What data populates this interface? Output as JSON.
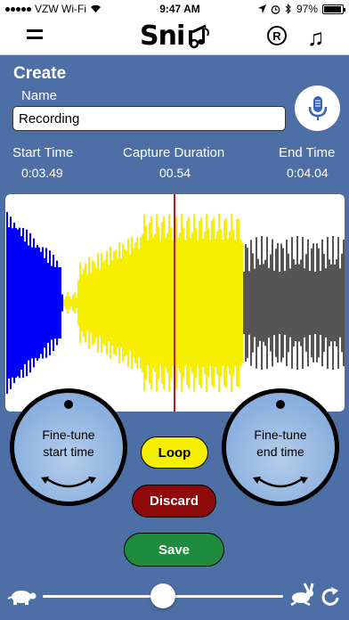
{
  "status": {
    "carrier": "VZW Wi-Fi",
    "time": "9:47 AM",
    "battery": "97%",
    "battery_level": 0.97
  },
  "nav": {
    "logo_text": "Sni",
    "reg_symbol": "R",
    "menu_icon": "menu-icon",
    "music_icon": "music-note-icon"
  },
  "create": {
    "title": "Create",
    "name_label": "Name",
    "name_value": "Recording"
  },
  "times": {
    "start_label": "Start Time",
    "start_value": "0:03.49",
    "duration_label": "Capture Duration",
    "duration_value": "00.54",
    "end_label": "End Time",
    "end_value": "0:04.04"
  },
  "waveform": {
    "colors": {
      "played": "#0000ff",
      "selected": "#f6f000",
      "remaining": "#555555",
      "playhead": "#c0161b"
    }
  },
  "knobs": {
    "start_line1": "Fine-tune",
    "start_line2": "start time",
    "end_line1": "Fine-tune",
    "end_line2": "end time"
  },
  "buttons": {
    "loop": "Loop",
    "discard": "Discard",
    "save": "Save"
  },
  "playback": {
    "speed_level": 0.5
  }
}
